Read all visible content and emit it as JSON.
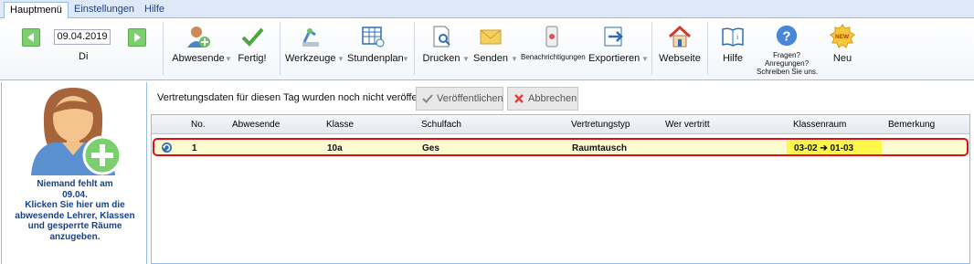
{
  "menu": {
    "tabs": [
      {
        "label": "Hauptmenü"
      },
      {
        "label": "Einstellungen"
      },
      {
        "label": "Hilfe"
      }
    ]
  },
  "toolbar": {
    "date_value": "09.04.2019",
    "day_label": "Di",
    "absent_label": "Abwesende",
    "done_label": "Fertig!",
    "tools_label": "Werkzeuge",
    "timetable_label": "Stundenplan",
    "print_label": "Drucken",
    "send_label": "Senden",
    "notifications_label": "Benachrichtigungen",
    "export_label": "Exportieren",
    "website_label": "Webseite",
    "help_label": "Hilfe",
    "questions_label_1": "Fragen?",
    "questions_label_2": "Anregungen?",
    "questions_label_3": "Schreiben Sie uns.",
    "new_label": "Neu",
    "new_badge": "NEW"
  },
  "left_panel": {
    "line1": "Niemand fehlt am",
    "line2": "09.04.",
    "line3": "Klicken  Sie hier um die",
    "line4": "abwesende Lehrer, Klassen",
    "line5": "und gesperrte Räume",
    "line6": "anzugeben."
  },
  "notice": {
    "text": "Vertretungsdaten für diesen Tag wurden noch nicht veröffentlicht.",
    "publish_label": "Veröffentlichen",
    "cancel_label": "Abbrechen"
  },
  "grid": {
    "headers": {
      "no": "No.",
      "absent": "Abwesende",
      "class": "Klasse",
      "subject": "Schulfach",
      "type": "Vertretungstyp",
      "substitute": "Wer vertritt",
      "room": "Klassenraum",
      "remark": "Bemerkung"
    },
    "rows": [
      {
        "no": "1",
        "absent": "",
        "class": "10a",
        "subject": "Ges",
        "type": "Raumtausch",
        "substitute": "",
        "room": "03-02 ➔ 01-03",
        "remark": ""
      }
    ]
  },
  "colors": {
    "accent": "#15428b",
    "highlight_border": "#d9121a",
    "row_bg": "#fdfcd0",
    "room_bg": "#fff84a"
  }
}
